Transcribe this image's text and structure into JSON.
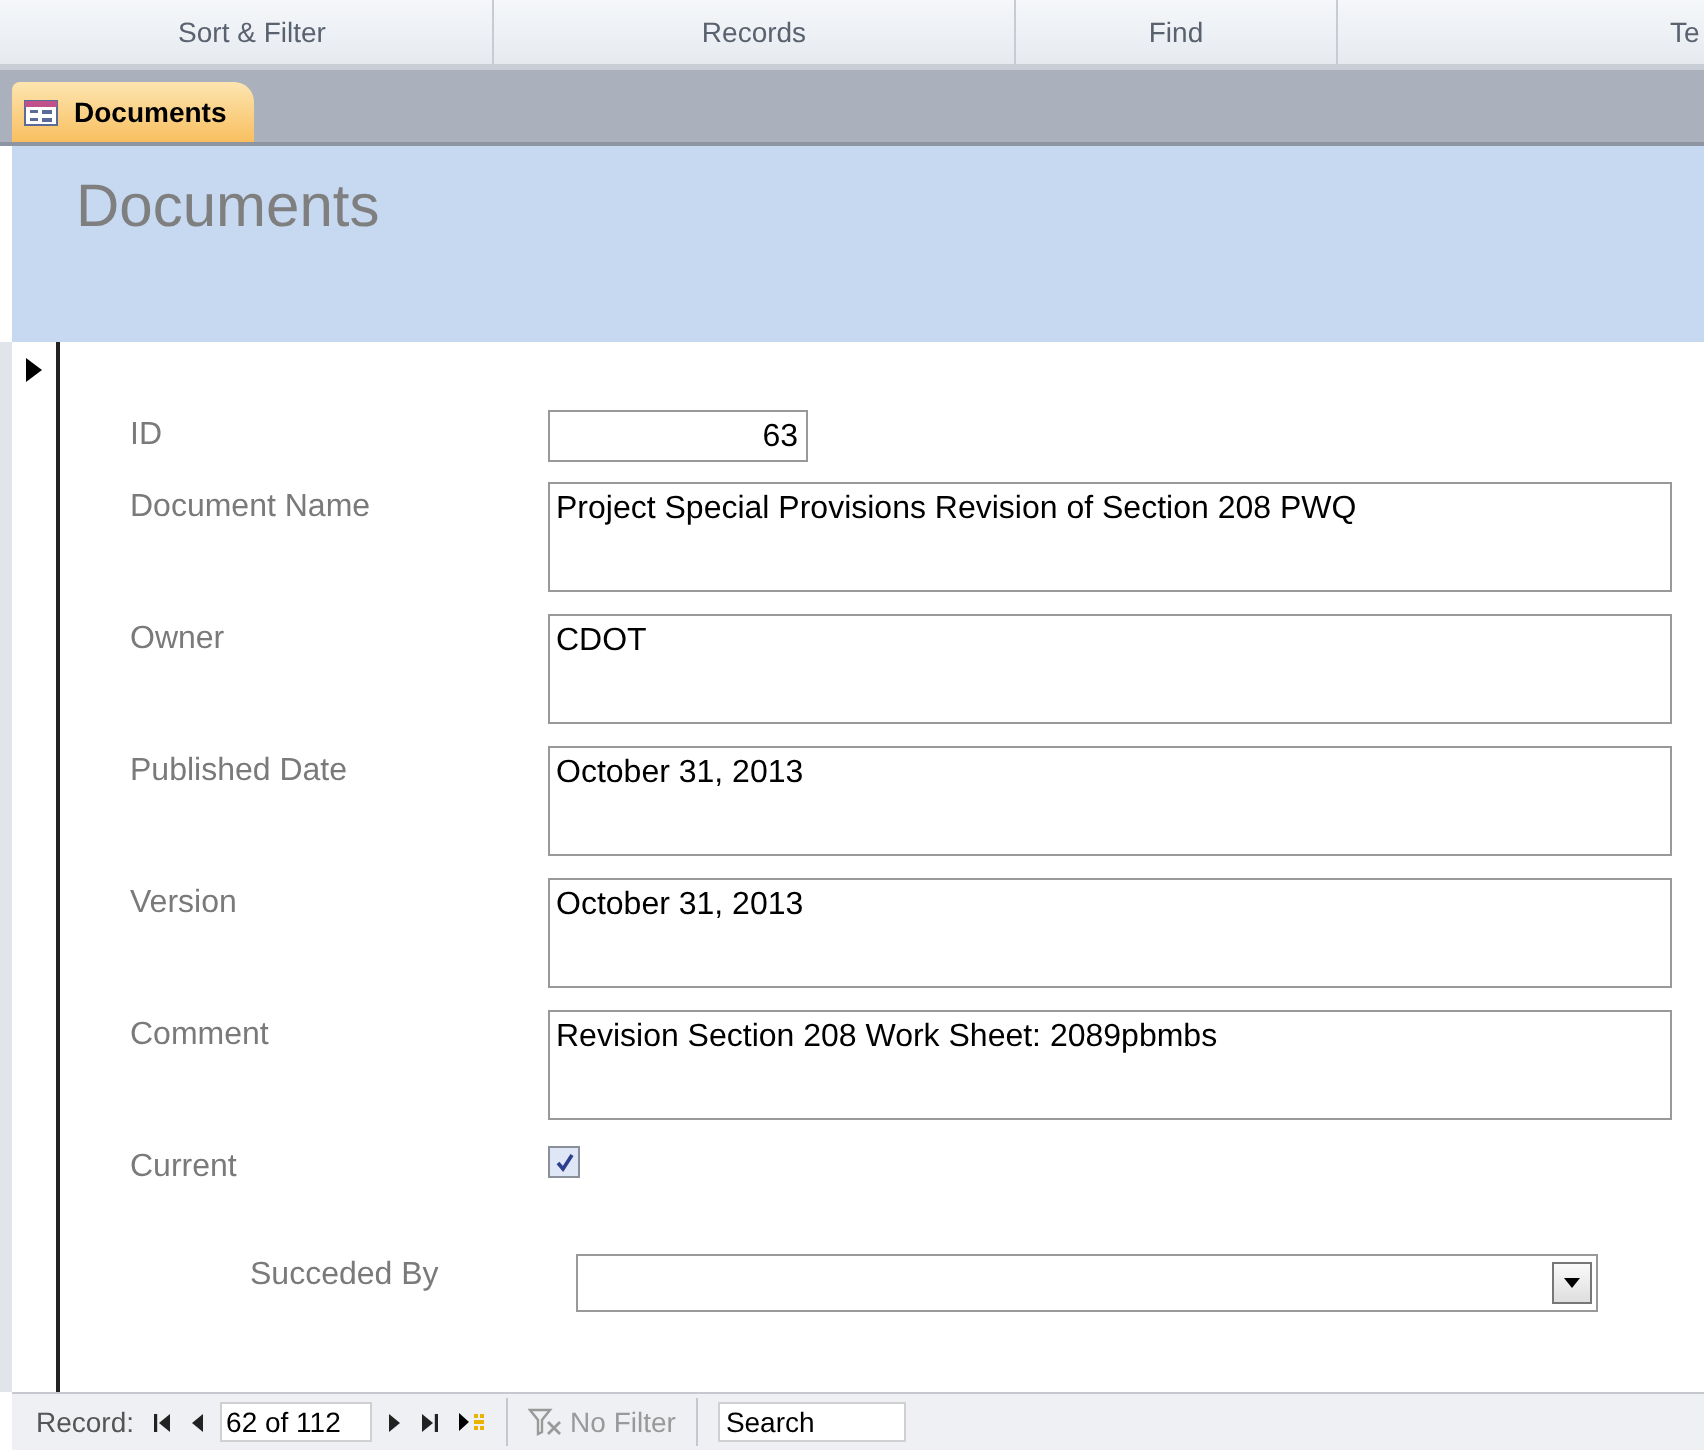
{
  "ribbon_groups": [
    {
      "label": "Sort & Filter"
    },
    {
      "label": "Records"
    },
    {
      "label": "Find"
    },
    {
      "label": "Te"
    }
  ],
  "tabs": [
    {
      "label": "Documents",
      "selected": true
    }
  ],
  "form": {
    "title": "Documents",
    "fields": [
      {
        "label": "ID",
        "kind": "number",
        "value": "63"
      },
      {
        "label": "Document Name",
        "kind": "memo",
        "value": "Project Special Provisions Revision of Section 208 PWQ"
      },
      {
        "label": "Owner",
        "kind": "memo",
        "value": "CDOT"
      },
      {
        "label": "Published Date",
        "kind": "memo",
        "value": "October 31, 2013"
      },
      {
        "label": "Version",
        "kind": "memo",
        "value": "October 31, 2013"
      },
      {
        "label": "Comment",
        "kind": "memo",
        "value": "Revision Section 208 Work Sheet: 2089pbmbs"
      },
      {
        "label": "Current",
        "kind": "checkbox",
        "checked": true
      },
      {
        "label": "Succeded By",
        "kind": "combo"
      }
    ]
  },
  "navigation": {
    "label": "Record:",
    "position": "62 of 112",
    "filter": "No Filter",
    "filter_disabled": true,
    "search": {
      "placeholder": "Search"
    }
  }
}
